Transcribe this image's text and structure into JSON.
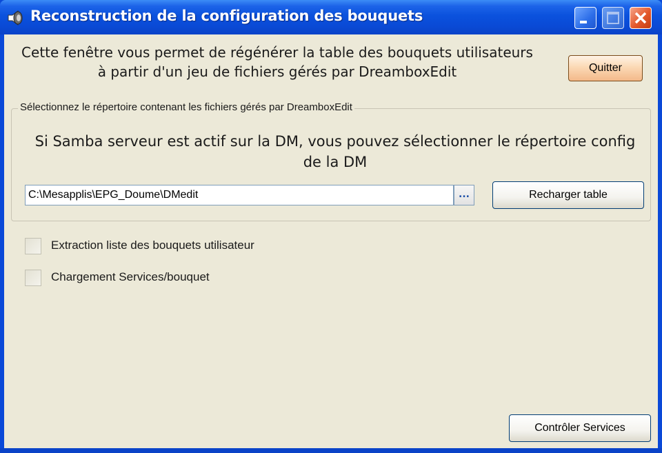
{
  "window": {
    "title": "Reconstruction de la configuration des bouquets",
    "icon": "speaker-icon",
    "controls": [
      "minimize",
      "maximize",
      "close"
    ]
  },
  "intro": {
    "text": "Cette fenêtre vous permet de régénérer la table des bouquets utilisateurs à partir d'un jeu de fichiers gérés par DreamboxEdit"
  },
  "buttons": {
    "quit": "Quitter",
    "reload_table": "Recharger table",
    "check_services": "Contrôler Services",
    "browse": "..."
  },
  "directory_group": {
    "legend": "Sélectionnez le répertoire contenant les fichiers gérés par DreamboxEdit",
    "note": "Si Samba serveur est actif sur la DM, vous pouvez sélectionner le répertoire config de la DM",
    "path_value": "C:\\Mesapplis\\EPG_Doume\\DMedit"
  },
  "checkboxes": [
    {
      "label": "Extraction liste des bouquets utilisateur",
      "checked": false
    },
    {
      "label": "Chargement Services/bouquet",
      "checked": false
    }
  ],
  "colors": {
    "titlebar": "#0a4ad6",
    "client_bg": "#ece9d8",
    "close_button": "#e3582b",
    "quit_button": "#fbd9b5"
  }
}
